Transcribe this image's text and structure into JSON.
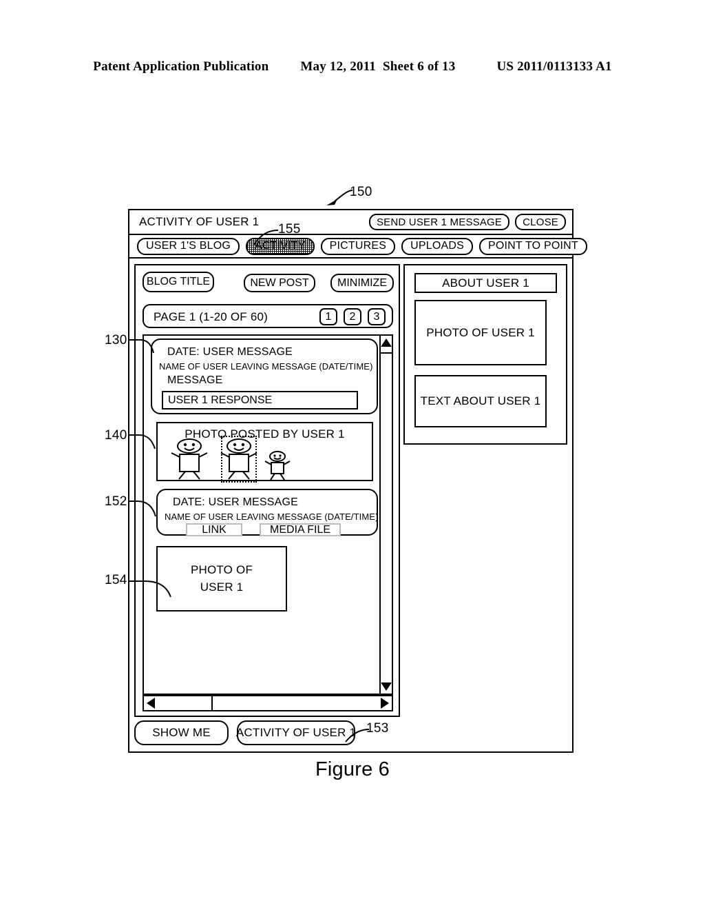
{
  "patent_header": {
    "publication": "Patent Application Publication",
    "date": "May 12, 2011",
    "sheet": "Sheet 6 of 13",
    "number": "US 2011/0113133 A1"
  },
  "figure_caption": "Figure 6",
  "callouts": [
    {
      "id": "150",
      "label": "150"
    },
    {
      "id": "155",
      "label": "155"
    },
    {
      "id": "130",
      "label": "130"
    },
    {
      "id": "140",
      "label": "140"
    },
    {
      "id": "152",
      "label": "152"
    },
    {
      "id": "154",
      "label": "154"
    },
    {
      "id": "153",
      "label": "153"
    }
  ],
  "window": {
    "title": "ACTIVITY OF USER 1",
    "send_message_button": "SEND USER 1 MESSAGE",
    "close_button": "CLOSE",
    "tabs": [
      {
        "label": "USER 1'S BLOG",
        "selected": false
      },
      {
        "label": "ACTIVITY",
        "selected": true
      },
      {
        "label": "PICTURES",
        "selected": false
      },
      {
        "label": "UPLOADS",
        "selected": false
      },
      {
        "label": "POINT TO POINT",
        "selected": false
      }
    ]
  },
  "blog_panel": {
    "blog_title_button": "BLOG TITLE",
    "new_post_button": "NEW POST",
    "minimize_button": "MINIMIZE",
    "pager": {
      "label": "PAGE 1 (1-20 OF 60)",
      "pages": [
        "1",
        "2",
        "3"
      ]
    },
    "feed": {
      "message_1": {
        "date_line": "DATE: USER MESSAGE",
        "name_line": "NAME OF USER LEAVING MESSAGE (DATE/TIME)",
        "body_label": "MESSAGE",
        "response_value": "USER 1 RESPONSE"
      },
      "photo_post": {
        "title": "PHOTO POSTED BY USER 1",
        "figures": [
          "adult-left",
          "adult-middle-selected",
          "child-right"
        ]
      },
      "message_2": {
        "date_line": "DATE: USER MESSAGE",
        "name_line": "NAME OF USER LEAVING MESSAGE (DATE/TIME)",
        "link_button": "LINK",
        "media_button": "MEDIA FILE"
      },
      "photo_of_user": {
        "line_1": "PHOTO OF",
        "line_2": "USER 1"
      }
    },
    "scrollbars": {
      "vertical_up_icon": "triangle-up-icon",
      "vertical_down_icon": "triangle-down-icon",
      "horizontal_left_icon": "triangle-left-icon",
      "horizontal_right_icon": "triangle-right-icon"
    }
  },
  "about_panel": {
    "header": "ABOUT USER 1",
    "photo_placeholder": "PHOTO OF USER 1",
    "text_placeholder": "TEXT ABOUT USER 1"
  },
  "footer": {
    "show_me_button": "SHOW ME",
    "activity_button": "ACTIVITY OF USER 1"
  }
}
